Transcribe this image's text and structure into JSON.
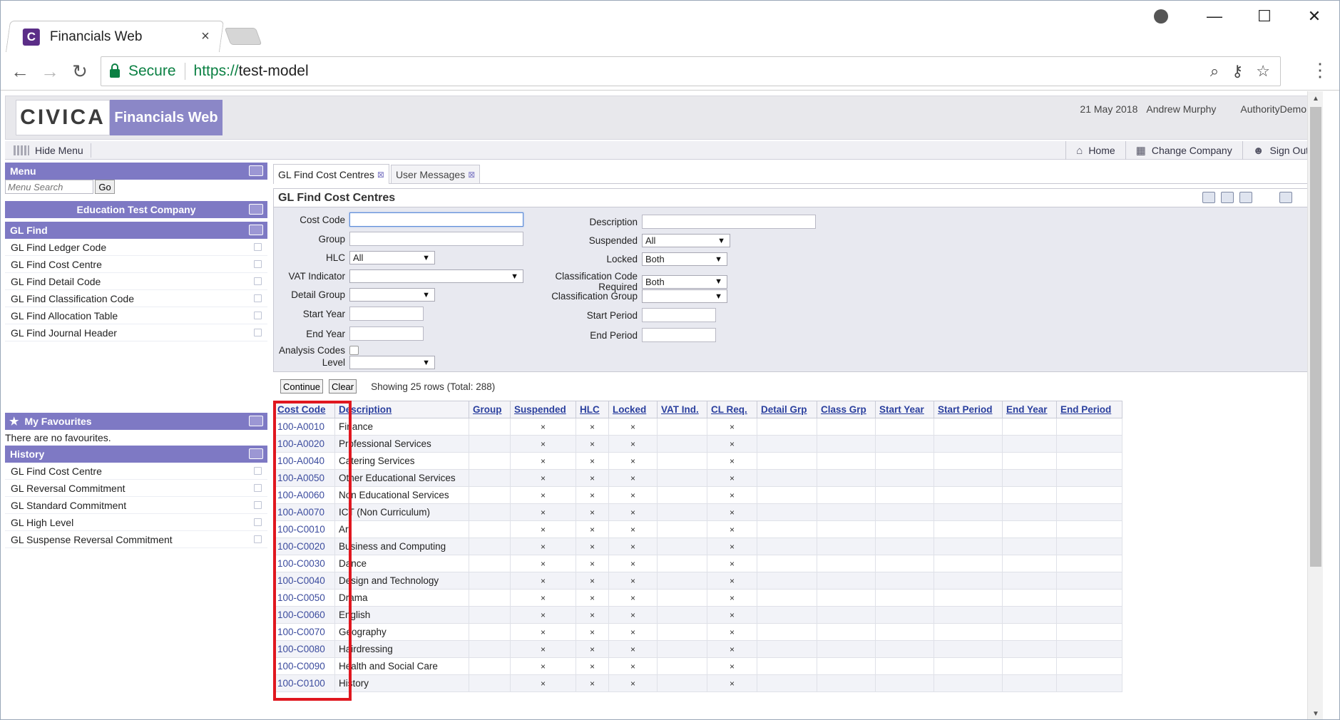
{
  "browser": {
    "tab_title": "Financials Web",
    "tab_close": "×",
    "secure_label": "Secure",
    "url_scheme": "https://",
    "url_host": "test-model"
  },
  "header": {
    "logo": "CIVICA",
    "product": "Financials Web",
    "date": "21 May 2018",
    "user": "Andrew Murphy",
    "authority": "AuthorityDemo"
  },
  "menubar": {
    "hide_menu": "Hide Menu",
    "links": [
      {
        "label": "Home",
        "icon": "home-icon"
      },
      {
        "label": "Change Company",
        "icon": "building-icon"
      },
      {
        "label": "Sign Out",
        "icon": "user-icon"
      }
    ]
  },
  "sidebar": {
    "menu_title": "Menu",
    "search_placeholder": "Menu Search",
    "go_label": "Go",
    "company": "Education Test Company",
    "gl_find_title": "GL Find",
    "gl_find_items": [
      "GL Find Ledger Code",
      "GL Find Cost Centre",
      "GL Find Detail Code",
      "GL Find Classification Code",
      "GL Find Allocation Table",
      "GL Find Journal Header"
    ],
    "favourites_title": "My Favourites",
    "favourites_empty": "There are no favourites.",
    "history_title": "History",
    "history_items": [
      "GL Find Cost Centre",
      "GL Reversal Commitment",
      "GL Standard Commitment",
      "GL High Level",
      "GL Suspense Reversal Commitment"
    ]
  },
  "tabs": [
    {
      "label": "GL Find Cost Centres",
      "active": true
    },
    {
      "label": "User Messages",
      "active": false
    }
  ],
  "form": {
    "title": "GL Find Cost Centres",
    "left": {
      "cost_code": "Cost Code",
      "group": "Group",
      "hlc": "HLC",
      "hlc_value": "All",
      "vat_indicator": "VAT Indicator",
      "detail_group": "Detail Group",
      "start_year": "Start Year",
      "end_year": "End Year",
      "analysis_codes": "Analysis Codes",
      "level": "Level"
    },
    "right": {
      "description": "Description",
      "suspended": "Suspended",
      "suspended_value": "All",
      "locked": "Locked",
      "locked_value": "Both",
      "class_req": "Classification Code Required",
      "class_req_value": "Both",
      "class_group": "Classification Group",
      "start_period": "Start Period",
      "end_period": "End Period"
    }
  },
  "actions": {
    "continue": "Continue",
    "clear": "Clear",
    "showing": "Showing 25 rows (Total: 288)"
  },
  "table": {
    "columns": [
      "Cost Code",
      "Description",
      "Group",
      "Suspended",
      "HLC",
      "Locked",
      "VAT Ind.",
      "CL Req.",
      "Detail Grp",
      "Class Grp",
      "Start Year",
      "Start Period",
      "End Year",
      "End Period"
    ],
    "mark": "×",
    "rows": [
      {
        "code": "100-A0010",
        "desc": "Finance"
      },
      {
        "code": "100-A0020",
        "desc": "Professional Services"
      },
      {
        "code": "100-A0040",
        "desc": "Catering Services"
      },
      {
        "code": "100-A0050",
        "desc": "Other Educational Services"
      },
      {
        "code": "100-A0060",
        "desc": "Non Educational Services"
      },
      {
        "code": "100-A0070",
        "desc": "ICT (Non Curriculum)"
      },
      {
        "code": "100-C0010",
        "desc": "Art"
      },
      {
        "code": "100-C0020",
        "desc": "Business and Computing"
      },
      {
        "code": "100-C0030",
        "desc": "Dance"
      },
      {
        "code": "100-C0040",
        "desc": "Design and Technology"
      },
      {
        "code": "100-C0050",
        "desc": "Drama"
      },
      {
        "code": "100-C0060",
        "desc": "English"
      },
      {
        "code": "100-C0070",
        "desc": "Geography"
      },
      {
        "code": "100-C0080",
        "desc": "Hairdressing"
      },
      {
        "code": "100-C0090",
        "desc": "Health and Social Care"
      },
      {
        "code": "100-C0100",
        "desc": "History"
      }
    ]
  },
  "colors": {
    "panel_header": "#7e79c4",
    "link": "#3c4c9e",
    "highlight": "#e0171f"
  }
}
